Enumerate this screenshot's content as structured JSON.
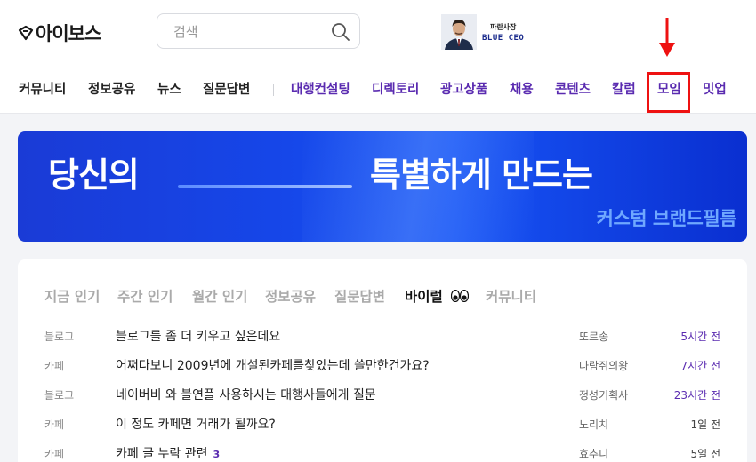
{
  "header": {
    "logo_text": "아이보스",
    "search": {
      "placeholder": "검색",
      "value": ""
    },
    "ad": {
      "small_text": "파란사장",
      "big_text": "BLUE CEO"
    }
  },
  "nav": {
    "items": [
      "커뮤니티",
      "정보공유",
      "뉴스",
      "질문답변",
      "대행컨설팅",
      "디렉토리",
      "광고상품",
      "채용",
      "콘텐츠",
      "칼럼",
      "모임",
      "밋업"
    ],
    "highlighted": "모임"
  },
  "banner": {
    "left_text": "당신의",
    "right_text": "특별하게 만드는",
    "sub_text": "커스텀 브랜드필름"
  },
  "feed": {
    "tabs": [
      "지금 인기",
      "주간 인기",
      "월간 인기",
      "정보공유",
      "질문답변",
      "바이럴",
      "커뮤니티"
    ],
    "active_tab": "바이럴",
    "rows": [
      {
        "category": "블로그",
        "title": "블로그를 좀 더 키우고 싶은데요",
        "count": "",
        "author": "또르송",
        "time": "5시간 전"
      },
      {
        "category": "카페",
        "title": "어쩌다보니 2009년에 개설된카페를찾았는데 쓸만한건가요?",
        "count": "",
        "author": "다람쥐의왕",
        "time": "7시간 전"
      },
      {
        "category": "블로그",
        "title": "네이버비 와 블연플 사용하시는 대행사들에게 질문",
        "count": "",
        "author": "정성기획사",
        "time": "23시간 전"
      },
      {
        "category": "카페",
        "title": "이 정도 카페면 거래가 될까요?",
        "count": "",
        "author": "노리치",
        "time": "1일 전"
      },
      {
        "category": "카페",
        "title": "카페 글 누락 관련",
        "count": "3",
        "author": "효추니",
        "time": "5일 전"
      }
    ]
  },
  "colors": {
    "accent_purple": "#5a2bb0",
    "highlight_red": "#ee1111",
    "banner_blue": "#1646e8"
  }
}
